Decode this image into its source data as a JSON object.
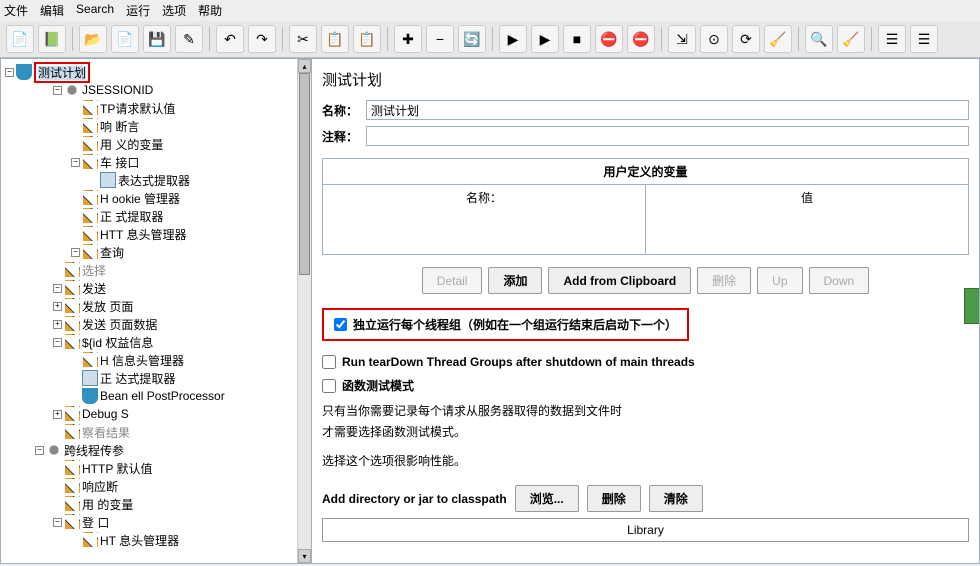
{
  "menubar": [
    "文件",
    "编辑",
    "Search",
    "运行",
    "选项",
    "帮助"
  ],
  "toolbar_icons": [
    "new-file-icon",
    "template-icon",
    "open-icon",
    "recent-icon",
    "save-icon",
    "edit-icon",
    "undo-icon",
    "redo-icon",
    "cut-icon",
    "copy-icon",
    "paste-icon",
    "plus-icon",
    "minus-icon",
    "toggle-icon",
    "start-icon",
    "start-remote-icon",
    "stop-icon",
    "remote-stop-icon",
    "stop-all-icon",
    "clear-icon",
    "clear-all-icon",
    "refresh-icon",
    "tidy-icon",
    "search-icon",
    "broom-icon",
    "list-icon",
    "tree-icon"
  ],
  "toolbar_glyphs": [
    "📄",
    "📗",
    "📂",
    "📄",
    "💾",
    "✎",
    "↶",
    "↷",
    "✂",
    "📋",
    "📋",
    "✚",
    "−",
    "🔄",
    "▶",
    "▶",
    "■",
    "⛔",
    "⛔",
    "⇲",
    "⊙",
    "⟳",
    "🧹",
    "🔍",
    "🧹",
    "☰",
    "☰"
  ],
  "tree_root_label": "测试计划",
  "tree": [
    {
      "depth": 0,
      "toggle": "-",
      "icon": "gear",
      "label": "JSESSIONID"
    },
    {
      "depth": 1,
      "toggle": "",
      "icon": "pencil",
      "label": "TP请求默认值"
    },
    {
      "depth": 1,
      "toggle": "",
      "icon": "pencil",
      "label": "响    断言"
    },
    {
      "depth": 1,
      "toggle": "",
      "icon": "pencil",
      "label": "用    义的变量"
    },
    {
      "depth": 1,
      "toggle": "-",
      "icon": "pencil",
      "label": "车        接口"
    },
    {
      "depth": 2,
      "toggle": "",
      "icon": "code",
      "label": "表达式提取器"
    },
    {
      "depth": 1,
      "toggle": "",
      "icon": "pencil",
      "label": "H         ookie 管理器"
    },
    {
      "depth": 1,
      "toggle": "",
      "icon": "pencil",
      "label": "正        式提取器"
    },
    {
      "depth": 1,
      "toggle": "",
      "icon": "pencil",
      "label": "HTT    息头管理器"
    },
    {
      "depth": 1,
      "toggle": "-",
      "icon": "pencil",
      "label": "查询    "
    },
    {
      "depth": 0,
      "toggle": "",
      "icon": "pencil",
      "label": "选择",
      "dim": true
    },
    {
      "depth": 0,
      "toggle": "-",
      "icon": "pencil",
      "label": "发送"
    },
    {
      "depth": 0,
      "toggle": "+",
      "icon": "pencil",
      "label": "发放        页面"
    },
    {
      "depth": 0,
      "toggle": "+",
      "icon": "pencil",
      "label": "发送        页面数据"
    },
    {
      "depth": 0,
      "toggle": "-",
      "icon": "pencil",
      "label": "${id        权益信息"
    },
    {
      "depth": 1,
      "toggle": "",
      "icon": "pencil",
      "label": "H       信息头管理器"
    },
    {
      "depth": 1,
      "toggle": "",
      "icon": "code",
      "label": "正         达式提取器"
    },
    {
      "depth": 1,
      "toggle": "",
      "icon": "beaker",
      "label": "Bean     ell PostProcessor"
    },
    {
      "depth": 0,
      "toggle": "+",
      "icon": "pencil",
      "label": "Debug S"
    },
    {
      "depth": 0,
      "toggle": "",
      "icon": "pencil",
      "label": "察看结果",
      "dim": true
    },
    {
      "depth": -1,
      "toggle": "-",
      "icon": "gear",
      "label": "跨线程传参"
    },
    {
      "depth": 0,
      "toggle": "",
      "icon": "pencil",
      "label": "HTTP         默认值"
    },
    {
      "depth": 0,
      "toggle": "",
      "icon": "pencil",
      "label": "响应断"
    },
    {
      "depth": 0,
      "toggle": "",
      "icon": "pencil",
      "label": "用         的变量"
    },
    {
      "depth": 0,
      "toggle": "-",
      "icon": "pencil",
      "label": "登        口"
    },
    {
      "depth": 1,
      "toggle": "",
      "icon": "pencil",
      "label": "HT       息头管理器"
    }
  ],
  "panel": {
    "title": "测试计划",
    "name_label": "名称：",
    "name_value": "测试计划",
    "comment_label": "注释：",
    "comment_value": "",
    "vars_title": "用户定义的变量",
    "col_name": "名称：",
    "col_value": "值",
    "btn_detail": "Detail",
    "btn_add": "添加",
    "btn_clip": "Add from Clipboard",
    "btn_delete": "删除",
    "btn_up": "Up",
    "btn_down": "Down",
    "check1": "独立运行每个线程组（例如在一个组运行结束后启动下一个）",
    "check2": "Run tearDown Thread Groups after shutdown of main threads",
    "check3": "函数测试模式",
    "info1": "只有当你需要记录每个请求从服务器取得的数据到文件时",
    "info2": "才需要选择函数测试模式。",
    "info3": "选择这个选项很影响性能。",
    "classpath_label": "Add directory or jar to classpath",
    "btn_browse": "浏览...",
    "btn_del2": "删除",
    "btn_clear": "清除",
    "library": "Library"
  }
}
